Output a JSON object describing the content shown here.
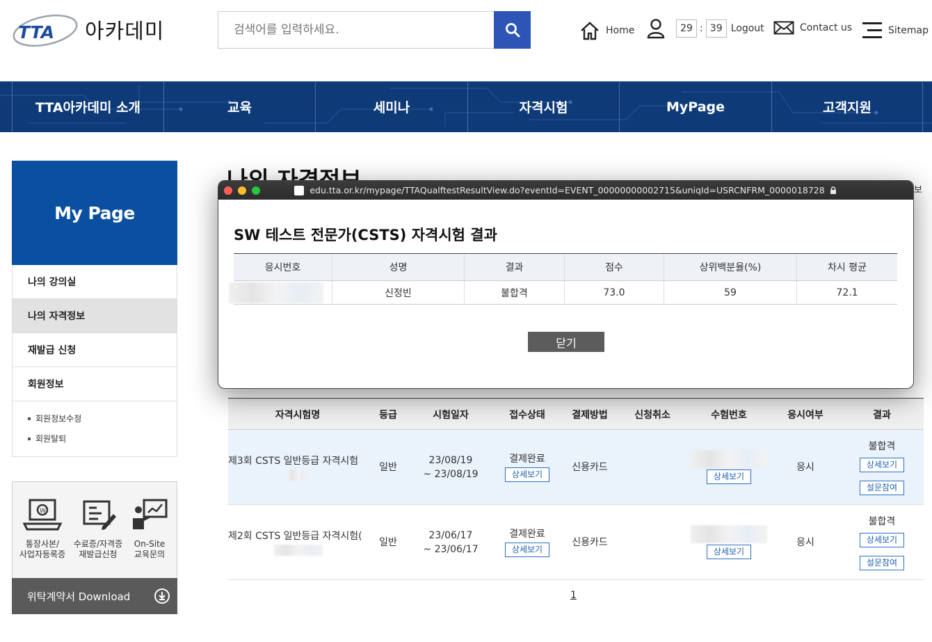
{
  "header": {
    "logo_mark": "TTA",
    "logo_text": "아카데미",
    "search_placeholder": "검색어를 입력하세요.",
    "links": {
      "home": "Home",
      "timer_min": "29",
      "timer_sep": ":",
      "timer_sec": "39",
      "logout": "Logout",
      "contact": "Contact us",
      "sitemap": "Sitemap"
    }
  },
  "gnb": [
    {
      "label": "TTA아카데미 소개"
    },
    {
      "label": "교육"
    },
    {
      "label": "세미나"
    },
    {
      "label": "자격시험"
    },
    {
      "label": "MyPage"
    },
    {
      "label": "고객지원"
    }
  ],
  "sidebar": {
    "title": "My Page",
    "items": [
      {
        "label": "나의 강의실"
      },
      {
        "label": "나의 자격정보"
      },
      {
        "label": "재발급 신청"
      },
      {
        "label": "회원정보"
      }
    ],
    "sub_items": [
      {
        "label": "회원정보수정"
      },
      {
        "label": "회원탈퇴"
      }
    ],
    "quick": [
      {
        "line1": "통장사본/",
        "line2": "사업자등록증"
      },
      {
        "line1": "수료증/자격증",
        "line2": "재발급신청"
      },
      {
        "line1": "On-Site",
        "line2": "교육문의"
      }
    ],
    "download": "위탁계약서 Download"
  },
  "page": {
    "title_partial": "나의 자격정보",
    "right_cut": "보"
  },
  "main_table": {
    "headers": [
      "자격시험명",
      "등급",
      "시험일자",
      "접수상태",
      "결제방법",
      "신청취소",
      "수험번호",
      "응시여부",
      "결과"
    ],
    "rows": [
      {
        "name": "제3회 CSTS 일반등급 자격시험",
        "grade": "일반",
        "date1": "23/08/19",
        "date2": "~ 23/08/19",
        "status": "결제완료",
        "status_btn": "상세보기",
        "payment": "신용카드",
        "cancel": "",
        "exam_btn": "상세보기",
        "attend": "응시",
        "result": "불합격",
        "result_btn1": "상세보기",
        "result_btn2": "설문참여"
      },
      {
        "name": "제2회 CSTS 일반등급 자격시험(",
        "grade": "일반",
        "date1": "23/06/17",
        "date2": "~ 23/06/17",
        "status": "결제완료",
        "status_btn": "상세보기",
        "payment": "신용카드",
        "cancel": "",
        "exam_btn": "상세보기",
        "attend": "응시",
        "result": "불합격",
        "result_btn1": "상세보기",
        "result_btn2": "설문참여"
      }
    ],
    "page_number": "1"
  },
  "popup": {
    "url": "edu.tta.or.kr/mypage/TTAQualftestResultView.do?eventId=EVENT_00000000002715&uniqId=USRCNFRM_0000018728",
    "title": "SW 테스트 전문가(CSTS) 자격시험 결과",
    "headers": [
      "응시번호",
      "성명",
      "결과",
      "점수",
      "상위백분율(%)",
      "차시 평균"
    ],
    "row": {
      "exam_no": "",
      "name": "신정빈",
      "result": "불합격",
      "score": "73.0",
      "percentile": "59",
      "average": "72.1"
    },
    "close_label": "닫기"
  },
  "colors": {
    "brand_blue": "#0a4fa0",
    "nav_blue": "#0e3b78",
    "search_blue": "#2c55b5"
  }
}
